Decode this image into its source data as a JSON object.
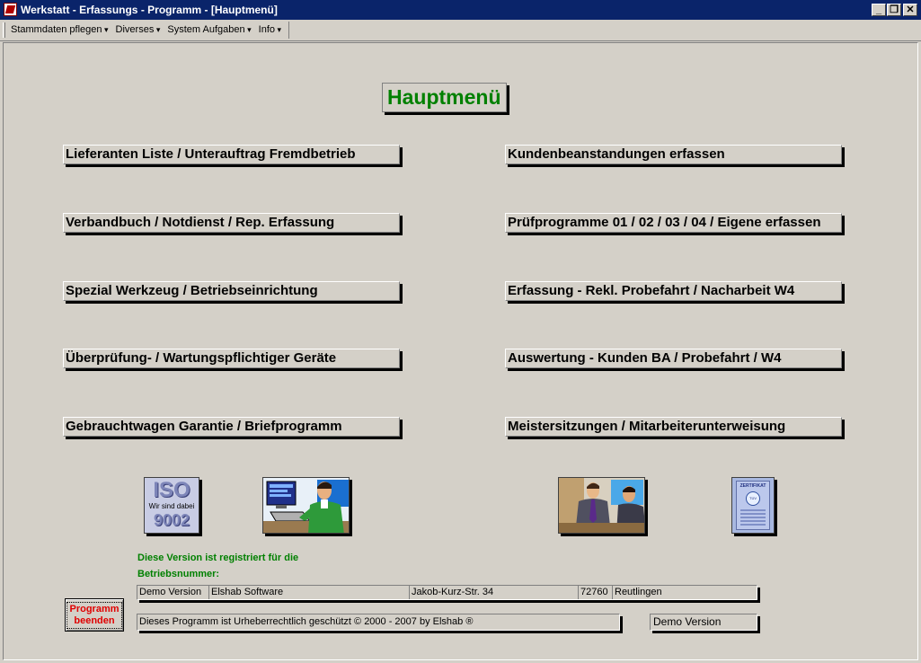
{
  "window": {
    "title": "Werkstatt - Erfassungs - Programm - [Hauptmenü]",
    "minimize_glyph": "_",
    "restore_glyph": "❐",
    "close_glyph": "✕"
  },
  "menu": [
    "Stammdaten pflegen",
    "Diverses",
    "System Aufgaben",
    "Info"
  ],
  "heading": "Hauptmenü",
  "buttons_left": [
    "Lieferanten Liste / Unterauftrag Fremdbetrieb",
    "Verbandbuch / Notdienst / Rep. Erfassung",
    "Spezial Werkzeug / Betriebseinrichtung",
    "Überprüfung- / Wartungspflichtiger Geräte",
    "Gebrauchtwagen Garantie / Briefprogramm"
  ],
  "buttons_right": [
    "Kundenbeanstandungen erfassen",
    "Prüfprogramme 01 / 02 / 03 / 04 / Eigene erfassen",
    "Erfassung - Rekl.  Probefahrt / Nacharbeit W4",
    "Auswertung - Kunden BA / Probefahrt / W4",
    "Meistersitzungen / Mitarbeiterunterweisung"
  ],
  "iso_logo": {
    "line1": "ISO",
    "line2": "Wir sind dabei",
    "line3": "9002"
  },
  "certificate": {
    "header": "ZERTIFIKAT",
    "seal": "TÜV"
  },
  "registration": {
    "line1": "Diese Version ist registriert für die",
    "line2": "Betriebsnummer:"
  },
  "license": {
    "name": "Demo Version",
    "company": "Elshab Software",
    "street": "Jakob-Kurz-Str. 34",
    "zip": "72760",
    "city": "Reutlingen"
  },
  "copyright": "Dieses Programm ist Urheberrechtlich geschützt © 2000 - 2007 by Elshab ®",
  "version_box": "Demo Version",
  "exit_button": "Programm\nbeenden",
  "colors": {
    "titlebar": "#0a246a",
    "heading_text": "#008000",
    "exit_text": "#e00000",
    "background": "#d4d0c8"
  }
}
